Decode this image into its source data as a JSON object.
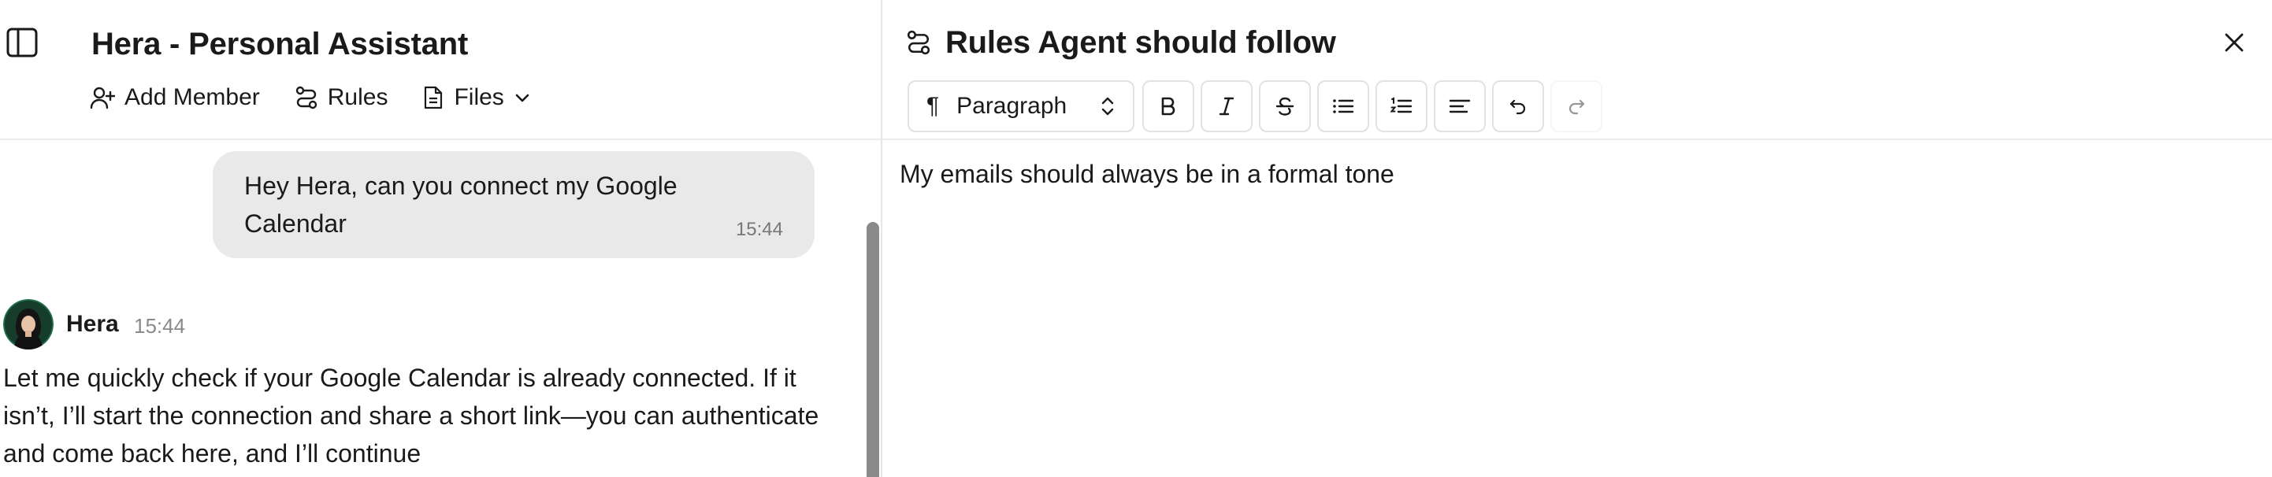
{
  "chat": {
    "title": "Hera - Personal Assistant",
    "actions": {
      "add_member": "Add Member",
      "rules": "Rules",
      "files": "Files"
    },
    "messages": {
      "user": {
        "text": "Hey Hera, can you connect my Google Calendar",
        "time": "15:44"
      },
      "assistant": {
        "sender": "Hera",
        "time": "15:44",
        "text": "Let me quickly check if your Google Calendar is already connected. If it isn’t, I’ll start the connection and share a short link—you can authenticate and come back here, and I’ll continue"
      }
    }
  },
  "rules_panel": {
    "title": "Rules Agent should follow",
    "toolbar": {
      "block_type": "Paragraph",
      "buttons": [
        "bold-icon",
        "italic-icon",
        "strikethrough-icon",
        "bullet-list-icon",
        "numbered-list-icon",
        "align-left-icon",
        "undo-icon",
        "redo-icon"
      ]
    },
    "content": "My emails should always be in a formal tone"
  },
  "icons": {
    "sidebar_toggle": "sidebar-icon",
    "add_member": "user-plus-icon",
    "rules": "route-icon",
    "files": "file-icon",
    "close": "close-icon"
  }
}
